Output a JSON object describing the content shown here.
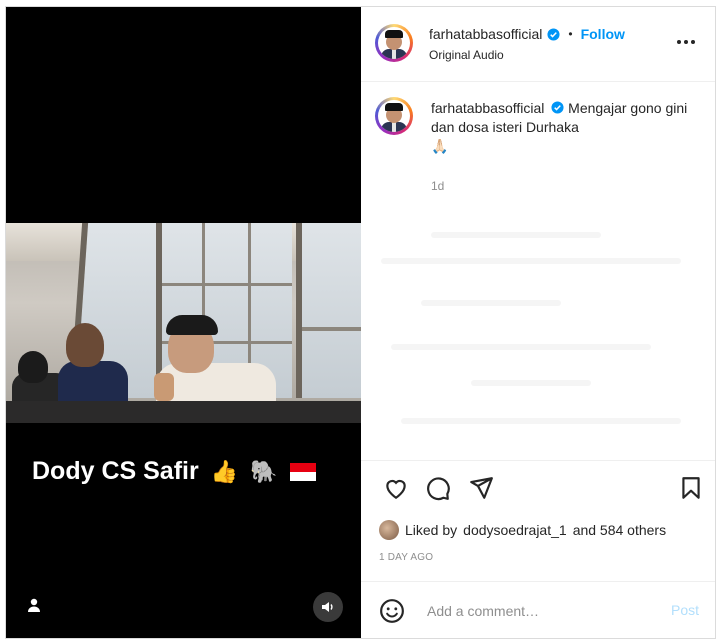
{
  "video": {
    "caption_text": "Dody CS  Safir",
    "caption_emojis": [
      "👍",
      "🐘"
    ],
    "flag_colors": [
      "#e70011",
      "#ffffff"
    ],
    "icons": {
      "user": "user-icon",
      "sound": "speaker-icon"
    }
  },
  "post": {
    "username": "farhatabbasofficial",
    "verified": true,
    "follow_label": "Follow",
    "separator": "•",
    "audio_label": "Original Audio",
    "caption": {
      "username": "farhatabbasofficial",
      "text": "Mengajar gono gini dan dosa isteri Durhaka",
      "emoji": "🙏🏻",
      "time": "1d"
    },
    "likes_text_prefix": "Liked by",
    "likes_user": "dodysoedrajat_1",
    "likes_text_suffix": "and 584 others",
    "timestamp": "1 DAY AGO",
    "comment_placeholder": "Add a comment…",
    "post_label": "Post"
  },
  "colors": {
    "accent": "#0095f6",
    "verified": "#0095f6",
    "post_disabled": "#b2dffc",
    "muted": "#8e8e8e"
  },
  "action_icons": [
    "heart-icon",
    "comment-icon",
    "share-icon",
    "bookmark-icon"
  ]
}
